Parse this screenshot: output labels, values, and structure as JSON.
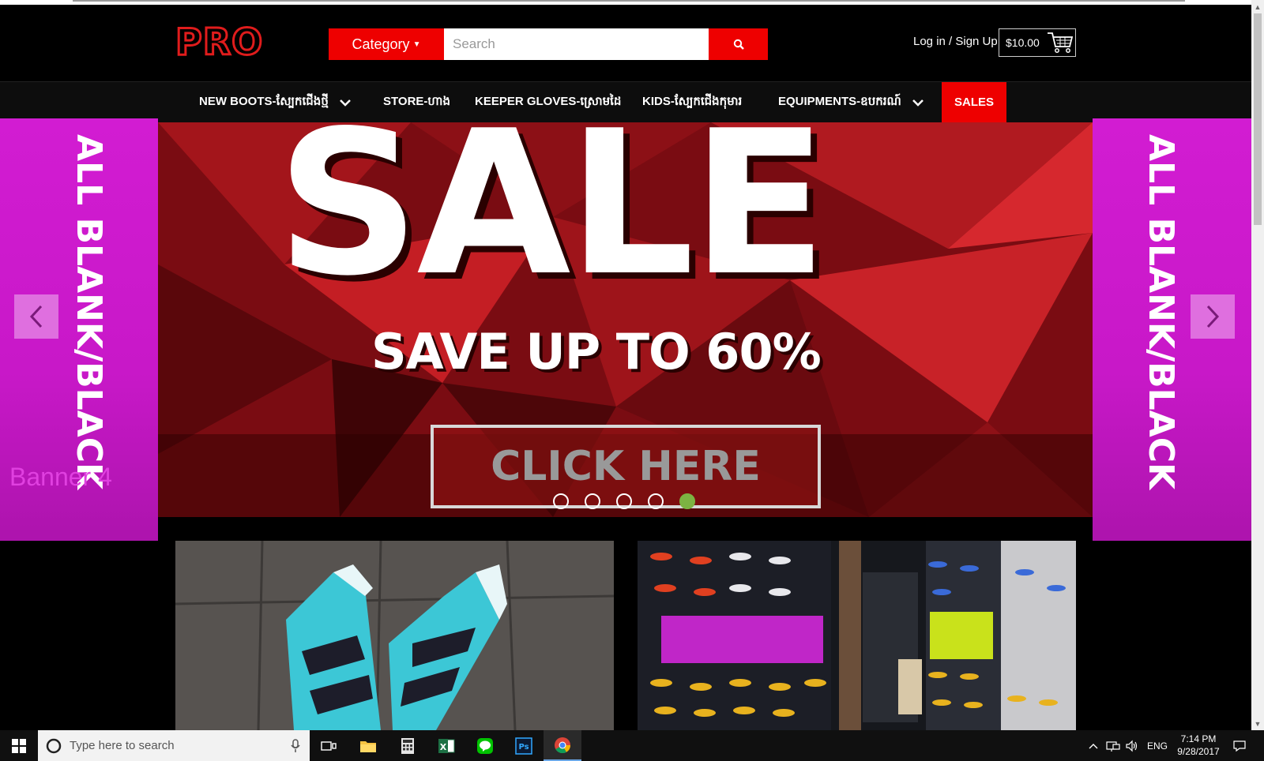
{
  "header": {
    "logo": "PRO",
    "category_label": "Category",
    "search_placeholder": "Search",
    "login_label": "Log in / Sign Up",
    "cart_amount": "$10.00"
  },
  "nav": {
    "items": [
      {
        "label": "NEW BOOTS-ស្បែកជើងថ្មី",
        "has_dropdown": true
      },
      {
        "label": "STORE-ហាង",
        "has_dropdown": false
      },
      {
        "label": "KEEPER GLOVES-ស្រោមដៃ",
        "has_dropdown": false
      },
      {
        "label": "KIDS-ស្បែកជើងកុមារ",
        "has_dropdown": false
      },
      {
        "label": "EQUIPMENTS-ឧបករណ៍",
        "has_dropdown": true
      },
      {
        "label": "SALES",
        "has_dropdown": false
      }
    ]
  },
  "banner": {
    "headline": "SALE",
    "subheadline": "SAVE UP TO 60%",
    "cta": "CLICK HERE",
    "caption": "Banner 4",
    "side_text": "ALL BLANK/BLACK",
    "slide_count": 5,
    "active_slide": 5,
    "colors": {
      "accent": "#e00000",
      "side_panel": "#d21cd2",
      "active_dot": "#7cb342"
    }
  },
  "taskbar": {
    "search_placeholder": "Type here to search",
    "language": "ENG",
    "time": "7:14 PM",
    "date": "9/28/2017",
    "apps": [
      "file-explorer-icon",
      "calculator-icon",
      "excel-icon",
      "line-icon",
      "photoshop-icon",
      "chrome-icon"
    ]
  }
}
